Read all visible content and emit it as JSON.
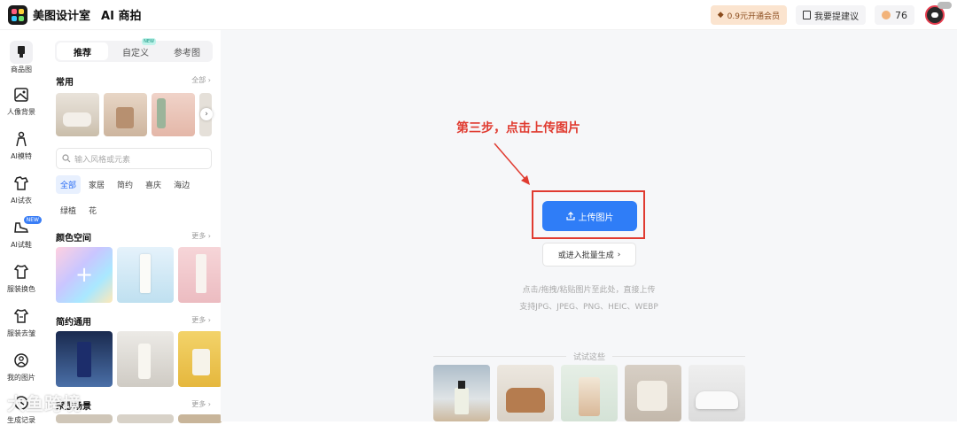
{
  "header": {
    "brand": "美图设计室",
    "product": "AI 商拍",
    "vip_label": "0.9元开通会员",
    "suggest_label": "我要提建议",
    "points": "76"
  },
  "leftnav": {
    "items": [
      {
        "label": "商品图",
        "icon": "product-icon"
      },
      {
        "label": "人像背景",
        "icon": "portrait-bg-icon"
      },
      {
        "label": "AI模特",
        "icon": "model-icon"
      },
      {
        "label": "AI试衣",
        "icon": "tryon-icon"
      },
      {
        "label": "AI试鞋",
        "icon": "shoe-icon",
        "badge": "NEW"
      },
      {
        "label": "服装换色",
        "icon": "shirt-icon"
      },
      {
        "label": "服装去皱",
        "icon": "shirt-iron-icon"
      },
      {
        "label": "我的图片",
        "icon": "user-icon"
      },
      {
        "label": "生成记录",
        "icon": "history-icon"
      }
    ]
  },
  "panel": {
    "tabs": [
      {
        "label": "推荐"
      },
      {
        "label": "自定义",
        "badge": "NEW"
      },
      {
        "label": "参考图"
      }
    ],
    "common_title": "常用",
    "common_more": "全部",
    "search_placeholder": "输入风格或元素",
    "chips_row1": [
      "全部",
      "家居",
      "简约",
      "喜庆",
      "海边"
    ],
    "chips_row2": [
      "绿植",
      "花"
    ],
    "color_title": "颜色空间",
    "color_more": "更多",
    "simple_title": "简约通用",
    "simple_more": "更多",
    "home_title": "家居场景",
    "home_more": "更多"
  },
  "main": {
    "annotation": "第三步，点击上传图片",
    "upload_label": "上传图片",
    "batch_label": "或进入批量生成",
    "hint1": "点击/拖拽/粘贴图片至此处，直接上传",
    "hint2": "支持JPG、JPEG、PNG、HEIC、WEBP",
    "try_label": "试试这些"
  },
  "watermark": "大鱼跨境",
  "colors": {
    "primary": "#2f7df7",
    "annotation": "#e03b30"
  }
}
